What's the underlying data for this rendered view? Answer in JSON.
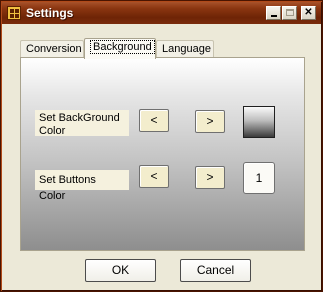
{
  "window": {
    "title": "Settings",
    "minimize_glyph": "",
    "close_glyph": "✕"
  },
  "tabs": [
    {
      "label": "Conversion"
    },
    {
      "label": "Background"
    },
    {
      "label": "Language"
    }
  ],
  "background_tab": {
    "background_color_label": "Set BackGround Color",
    "buttons_color_label": "Set Buttons Color",
    "prev_label": "<",
    "next_label": ">",
    "buttons_color_index": "1"
  },
  "dialog": {
    "ok_label": "OK",
    "cancel_label": "Cancel"
  }
}
